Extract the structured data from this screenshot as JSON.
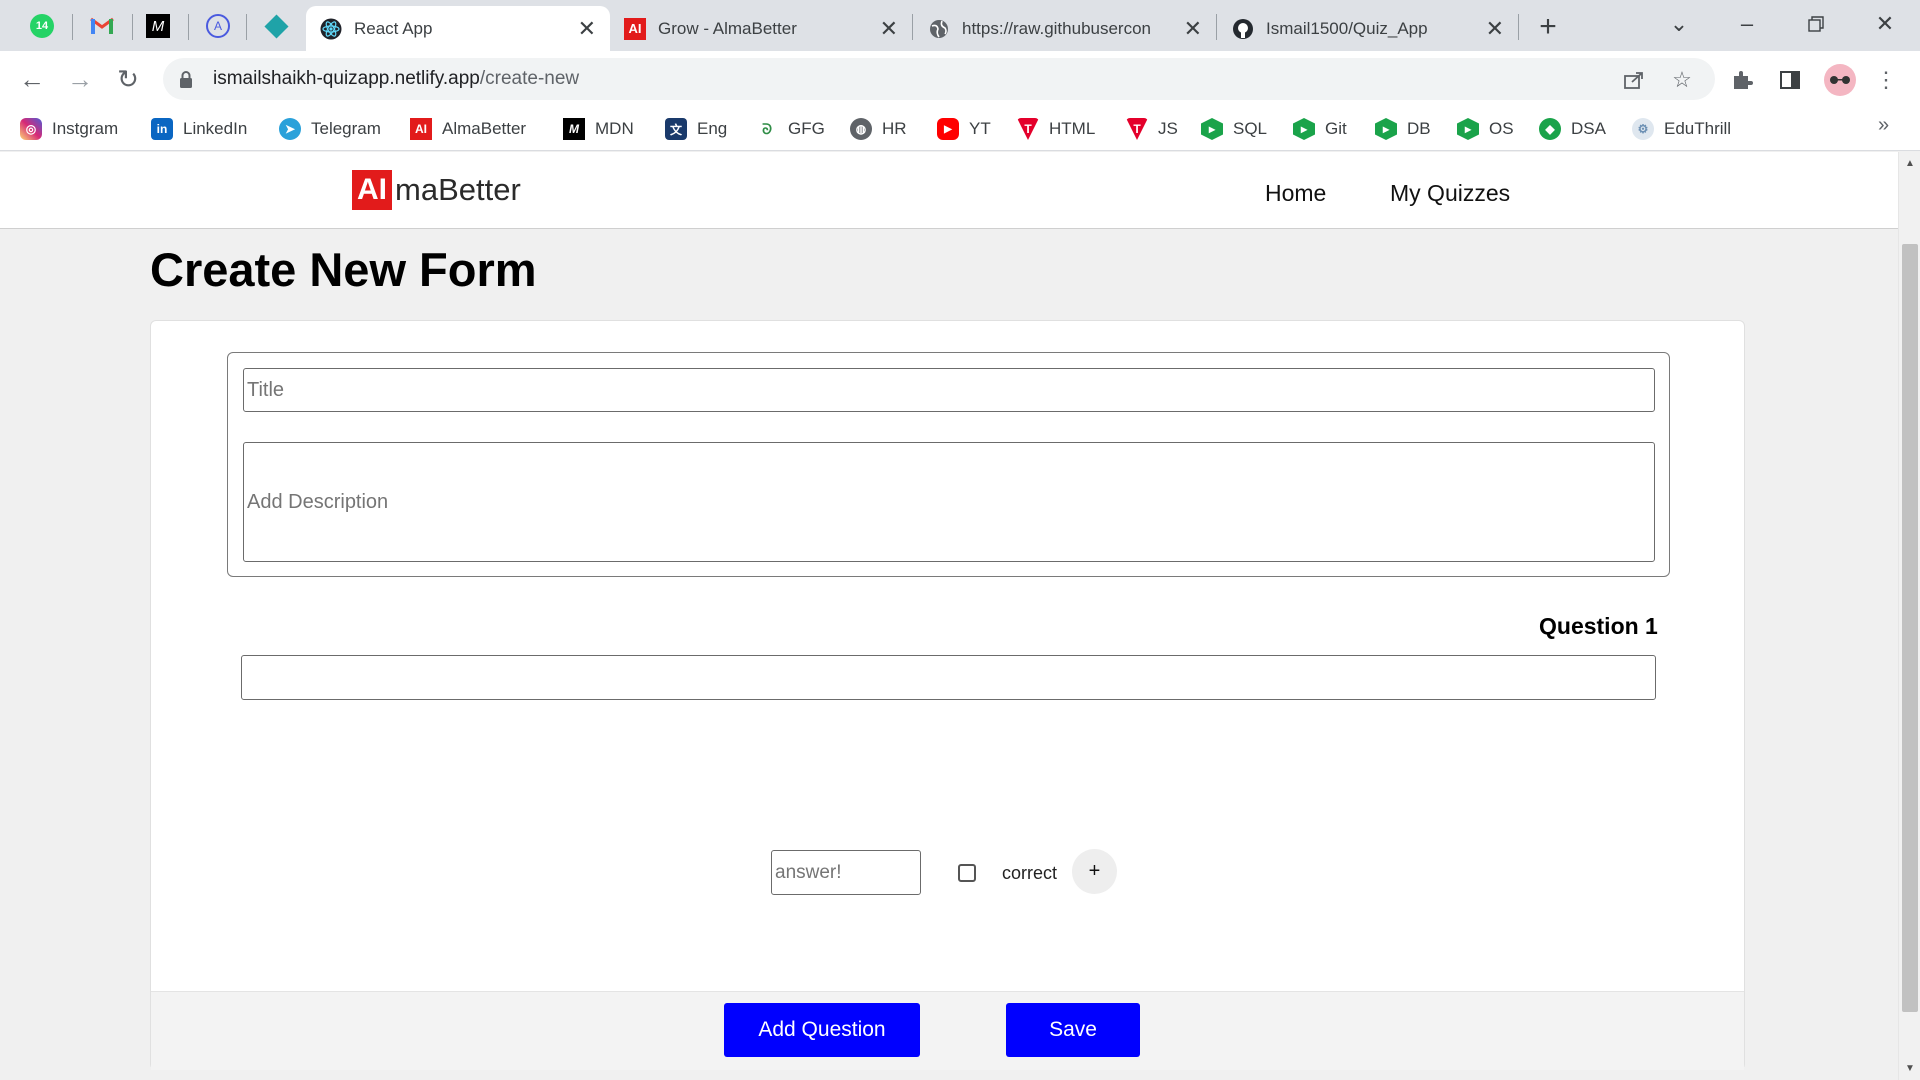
{
  "browser": {
    "pinned_tabs": [
      {
        "name": "whatsapp",
        "badge": "14"
      },
      {
        "name": "gmail",
        "icon": "gmail-icon"
      },
      {
        "name": "mdn",
        "icon": "mdn-icon"
      },
      {
        "name": "codeforces",
        "icon": "code-icon"
      },
      {
        "name": "app",
        "icon": "diamond-icon"
      }
    ],
    "tabs": [
      {
        "title": "React App",
        "icon": "react-icon",
        "active": true
      },
      {
        "title": "Grow - AlmaBetter",
        "icon": "almabetter-icon",
        "active": false
      },
      {
        "title": "https://raw.githubusercon",
        "icon": "globe-icon",
        "active": false
      },
      {
        "title": "Ismail1500/Quiz_App",
        "icon": "github-icon",
        "active": false
      }
    ],
    "new_tab": "+",
    "url_host": "ismailshaikh-quizapp.netlify.app",
    "url_path": "/create-new",
    "bookmarks": [
      {
        "label": "Instgram",
        "icon": "instagram-icon",
        "color": "#d62976"
      },
      {
        "label": "LinkedIn",
        "icon": "linkedin-icon",
        "color": "#0a66c2"
      },
      {
        "label": "Telegram",
        "icon": "telegram-icon",
        "color": "#2aa1da"
      },
      {
        "label": "AlmaBetter",
        "icon": "almabetter-icon",
        "color": "#e21b1b"
      },
      {
        "label": "MDN",
        "icon": "mdn-icon",
        "color": "#000000"
      },
      {
        "label": "Eng",
        "icon": "translate-icon",
        "color": "#1a3a6b"
      },
      {
        "label": "GFG",
        "icon": "gfg-icon",
        "color": "#2f8d46"
      },
      {
        "label": "HR",
        "icon": "globe-icon",
        "color": "#5f6368"
      },
      {
        "label": "YT",
        "icon": "youtube-icon",
        "color": "#ff0000"
      },
      {
        "label": "HTML",
        "icon": "tutorial-icon",
        "color": "#e4002b"
      },
      {
        "label": "JS",
        "icon": "tutorial-icon",
        "color": "#e4002b"
      },
      {
        "label": "SQL",
        "icon": "hex-icon",
        "color": "#1aa34a"
      },
      {
        "label": "Git",
        "icon": "hex-icon",
        "color": "#1aa34a"
      },
      {
        "label": "DB",
        "icon": "hex-icon",
        "color": "#1aa34a"
      },
      {
        "label": "OS",
        "icon": "hex-icon",
        "color": "#1aa34a"
      },
      {
        "label": "DSA",
        "icon": "dsa-icon",
        "color": "#1aa34a"
      },
      {
        "label": "EduThrill",
        "icon": "eduthrill-icon",
        "color": "#6b8fb3"
      }
    ]
  },
  "site": {
    "logo_mark": "AI",
    "logo_text": "maBetter",
    "nav": {
      "home": "Home",
      "my_quizzes": "My Quizzes"
    }
  },
  "form": {
    "page_title": "Create New Form",
    "title_placeholder": "Title",
    "description_placeholder": "Add Description",
    "question_label": "Question 1",
    "question_value": "",
    "answer_placeholder": "answer!",
    "correct_label": "correct",
    "add_option": "+",
    "add_question": "Add Question",
    "save": "Save"
  },
  "colors": {
    "primary_button": "#0000ff",
    "brand_red": "#e21b1b"
  }
}
